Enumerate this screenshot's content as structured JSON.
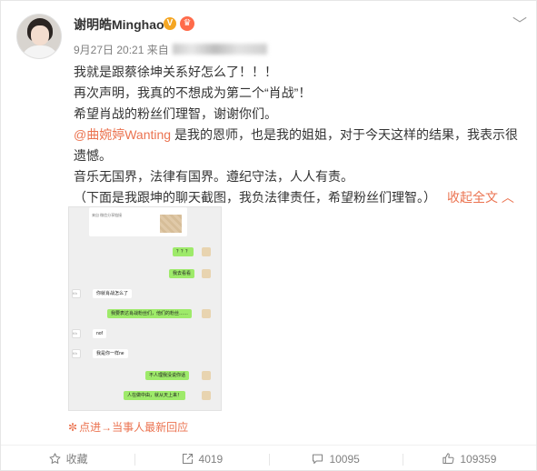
{
  "user": {
    "name": "谢明皓Minghao",
    "verified_badge": "V",
    "crown_badge": "♛"
  },
  "meta": {
    "timestamp": "9月27日 20:21",
    "source_prefix": "来自"
  },
  "menu_glyph": "﹀",
  "post": {
    "line1": "我就是跟蔡徐坤关系好怎么了！！！",
    "line2": "再次声明，我真的不想成为第二个“肖战”！",
    "line3": "希望肖战的粉丝们理智，谢谢你们。",
    "mention": "@曲婉婷Wanting",
    "line4_rest": " 是我的恩师，也是我的姐姐，对于今天这样的结果，我表示很遗憾。",
    "line5": "音乐无国界，法律有国界。遵纪守法，人人有责。",
    "line6": "（下面是我跟坤的聊天截图，我负法律责任，希望粉丝们理智。）",
    "collapse_label": "收起全文 ︿"
  },
  "chat": {
    "top_text": "来自 微信分享链接",
    "msgs": [
      {
        "side": "me",
        "text": "？？？"
      },
      {
        "side": "me",
        "text": "我去看看"
      },
      {
        "side": "other",
        "name": "Kh",
        "text": "你就肖战怎么了"
      },
      {
        "side": "me",
        "text": "我要表达肖战粉丝们，他们的粉丝……"
      },
      {
        "side": "other",
        "name": "Kh",
        "text": "nof"
      },
      {
        "side": "other",
        "name": "Kh",
        "text": "我是你一样ne"
      },
      {
        "side": "me",
        "text": "不人理我没说你话"
      },
      {
        "side": "me",
        "text": "人在做中由，就从天上来！"
      }
    ]
  },
  "origin_link": {
    "symbol": "✼",
    "label": "点进→当事人最新回应"
  },
  "actions": {
    "favorite": "收藏",
    "repost": "4019",
    "comment": "10095",
    "like": "109359"
  }
}
